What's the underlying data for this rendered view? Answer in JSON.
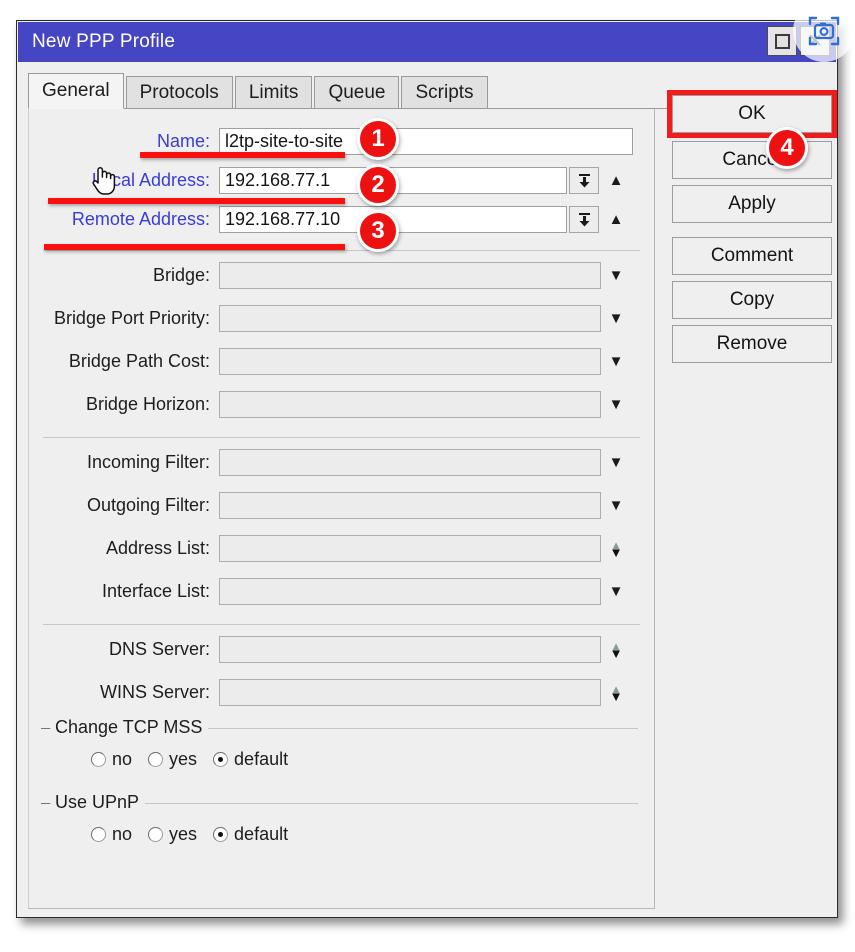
{
  "window": {
    "title": "New PPP Profile",
    "controls": {
      "maximize": "□",
      "close": "✕"
    }
  },
  "tabs": [
    {
      "label": "General",
      "active": true
    },
    {
      "label": "Protocols",
      "active": false
    },
    {
      "label": "Limits",
      "active": false
    },
    {
      "label": "Queue",
      "active": false
    },
    {
      "label": "Scripts",
      "active": false
    }
  ],
  "form": {
    "name": {
      "label": "Name:",
      "value": "l2tp-site-to-site"
    },
    "local_address": {
      "label": "Local Address:",
      "value": "192.168.77.1"
    },
    "remote_address": {
      "label": "Remote Address:",
      "value": "192.168.77.10"
    },
    "bridge": {
      "label": "Bridge:",
      "value": ""
    },
    "bridge_port_priority": {
      "label": "Bridge Port Priority:",
      "value": ""
    },
    "bridge_path_cost": {
      "label": "Bridge Path Cost:",
      "value": ""
    },
    "bridge_horizon": {
      "label": "Bridge Horizon:",
      "value": ""
    },
    "incoming_filter": {
      "label": "Incoming Filter:",
      "value": ""
    },
    "outgoing_filter": {
      "label": "Outgoing Filter:",
      "value": ""
    },
    "address_list": {
      "label": "Address List:",
      "value": ""
    },
    "interface_list": {
      "label": "Interface List:",
      "value": ""
    },
    "dns_server": {
      "label": "DNS Server:",
      "value": ""
    },
    "wins_server": {
      "label": "WINS Server:",
      "value": ""
    }
  },
  "groups": {
    "change_tcp_mss": {
      "title": "Change TCP MSS",
      "options": [
        {
          "label": "no",
          "selected": false
        },
        {
          "label": "yes",
          "selected": false
        },
        {
          "label": "default",
          "selected": true
        }
      ]
    },
    "use_upnp": {
      "title": "Use UPnP",
      "options": [
        {
          "label": "no",
          "selected": false
        },
        {
          "label": "yes",
          "selected": false
        },
        {
          "label": "default",
          "selected": true
        }
      ]
    }
  },
  "buttons": [
    {
      "label": "OK",
      "highlighted": true
    },
    {
      "label": "Cancel",
      "highlighted": false
    },
    {
      "label": "Apply",
      "highlighted": false
    },
    {
      "label": "Comment",
      "highlighted": false
    },
    {
      "label": "Copy",
      "highlighted": false
    },
    {
      "label": "Remove",
      "highlighted": false
    }
  ],
  "annotations": {
    "badges": [
      {
        "number": "1",
        "target": "name-field"
      },
      {
        "number": "2",
        "target": "local-address-field"
      },
      {
        "number": "3",
        "target": "remote-address-field"
      },
      {
        "number": "4",
        "target": "ok-button"
      }
    ],
    "highlight_color": "#f21b1b",
    "badge_color": "#ee1111"
  }
}
